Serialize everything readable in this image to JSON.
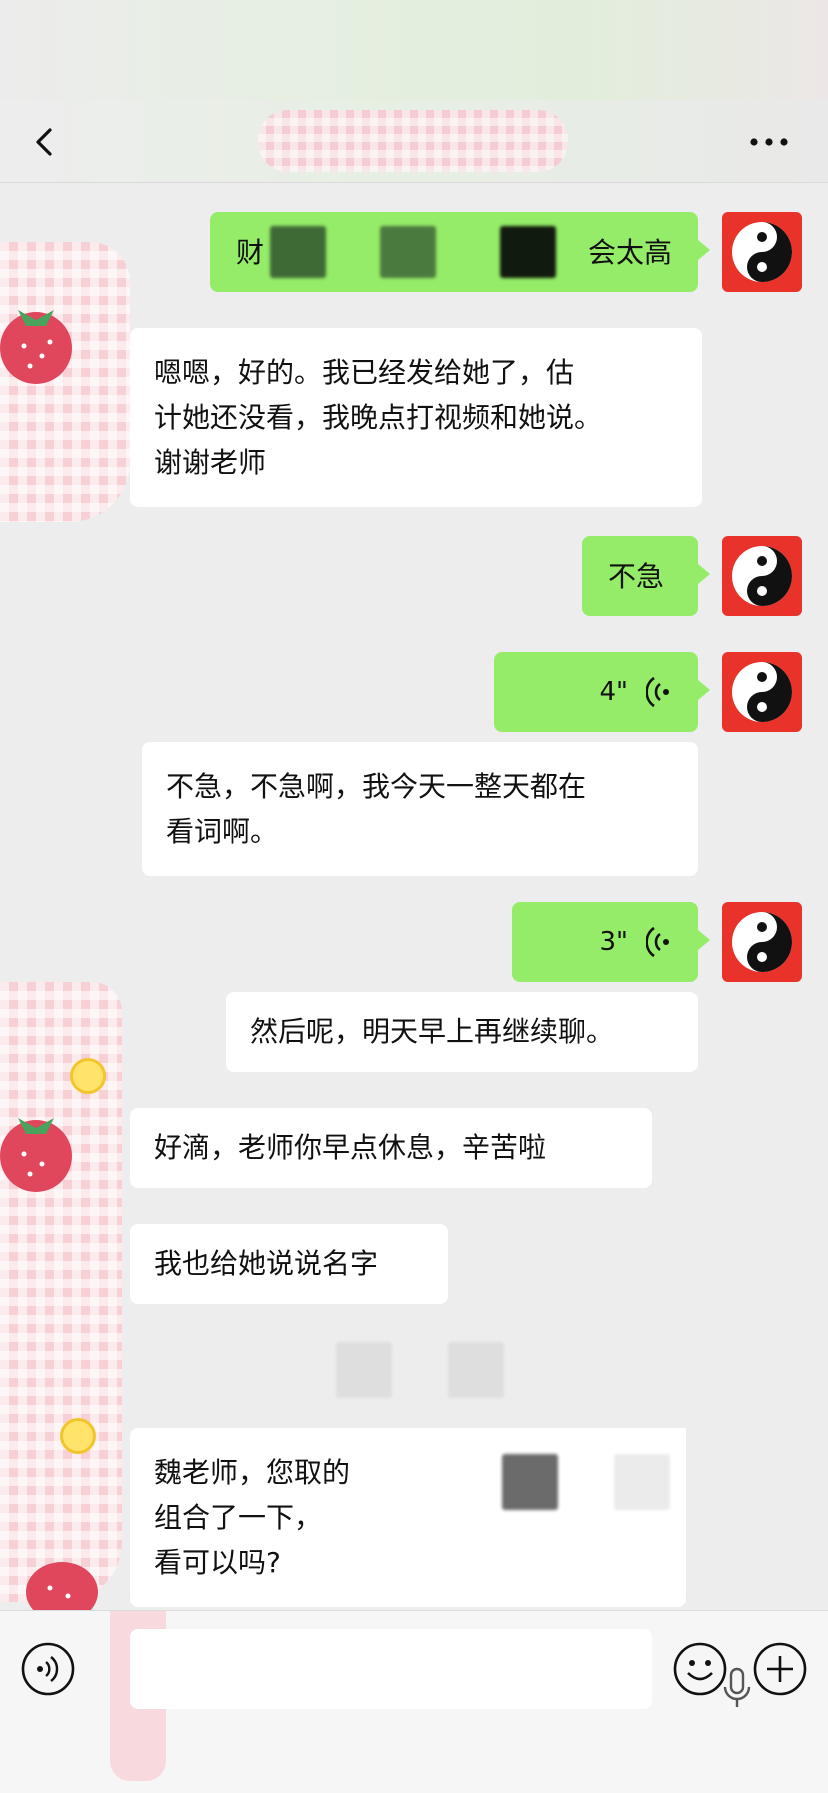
{
  "header": {
    "back_icon": "chevron-left-icon",
    "more_icon": "ellipsis-icon"
  },
  "messages": [
    {
      "side": "right",
      "type": "text",
      "text_start": "财",
      "text_end": "会太高"
    },
    {
      "side": "left",
      "type": "text",
      "text": "嗯嗯，好的。我已经发给她了，估\n计她还没看，我晚点打视频和她说。\n谢谢老师"
    },
    {
      "side": "right",
      "type": "text",
      "text": "不急"
    },
    {
      "side": "right",
      "type": "voice",
      "duration": "4\""
    },
    {
      "side": "right",
      "type": "text",
      "text": "不急，不急啊，我今天一整天都在\n看词啊。"
    },
    {
      "side": "right",
      "type": "voice",
      "duration": "3\""
    },
    {
      "side": "right",
      "type": "text",
      "text": "然后呢，明天早上再继续聊。"
    },
    {
      "side": "left",
      "type": "text",
      "text": "好滴，老师你早点休息，辛苦啦"
    },
    {
      "side": "left",
      "type": "text",
      "text": "我也给她说说名字"
    },
    {
      "side": "left",
      "type": "text",
      "text": "魏老师，您取的\n组合了一下，\n看可以吗?"
    }
  ],
  "colors": {
    "chat_bg": "#ededed",
    "bubble_green": "#95ec69",
    "bubble_white": "#ffffff",
    "avatar_red": "#e8322a"
  },
  "input_bar": {
    "voice_icon": "voice-mode-icon",
    "mic_icon": "microphone-icon",
    "emoji_icon": "emoji-icon",
    "plus_icon": "plus-icon"
  }
}
